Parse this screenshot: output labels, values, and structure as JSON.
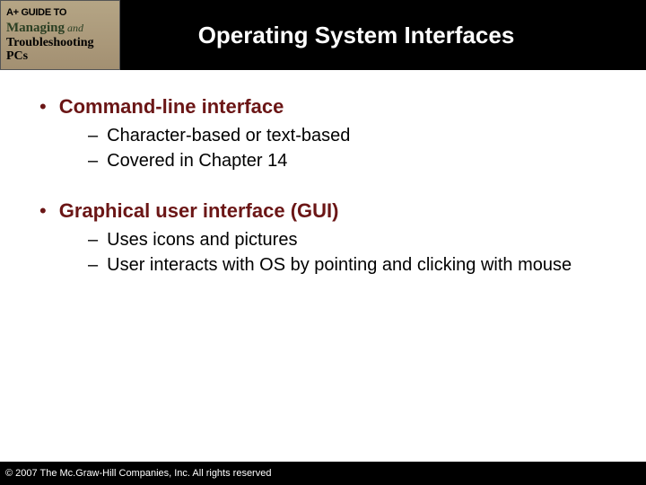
{
  "logo": {
    "top": "A+ GUIDE TO",
    "line1_a": "Managing",
    "line1_and": " and",
    "line2": "Troubleshooting PCs"
  },
  "title": "Operating System Interfaces",
  "bullets": [
    {
      "heading": "Command-line interface",
      "subs": [
        "Character-based or text-based",
        "Covered in Chapter 14"
      ]
    },
    {
      "heading": "Graphical user interface (GUI)",
      "subs": [
        "Uses icons and pictures",
        "User interacts with OS by pointing and clicking with mouse"
      ]
    }
  ],
  "footer": "© 2007 The Mc.Graw-Hill Companies, Inc. All rights reserved"
}
